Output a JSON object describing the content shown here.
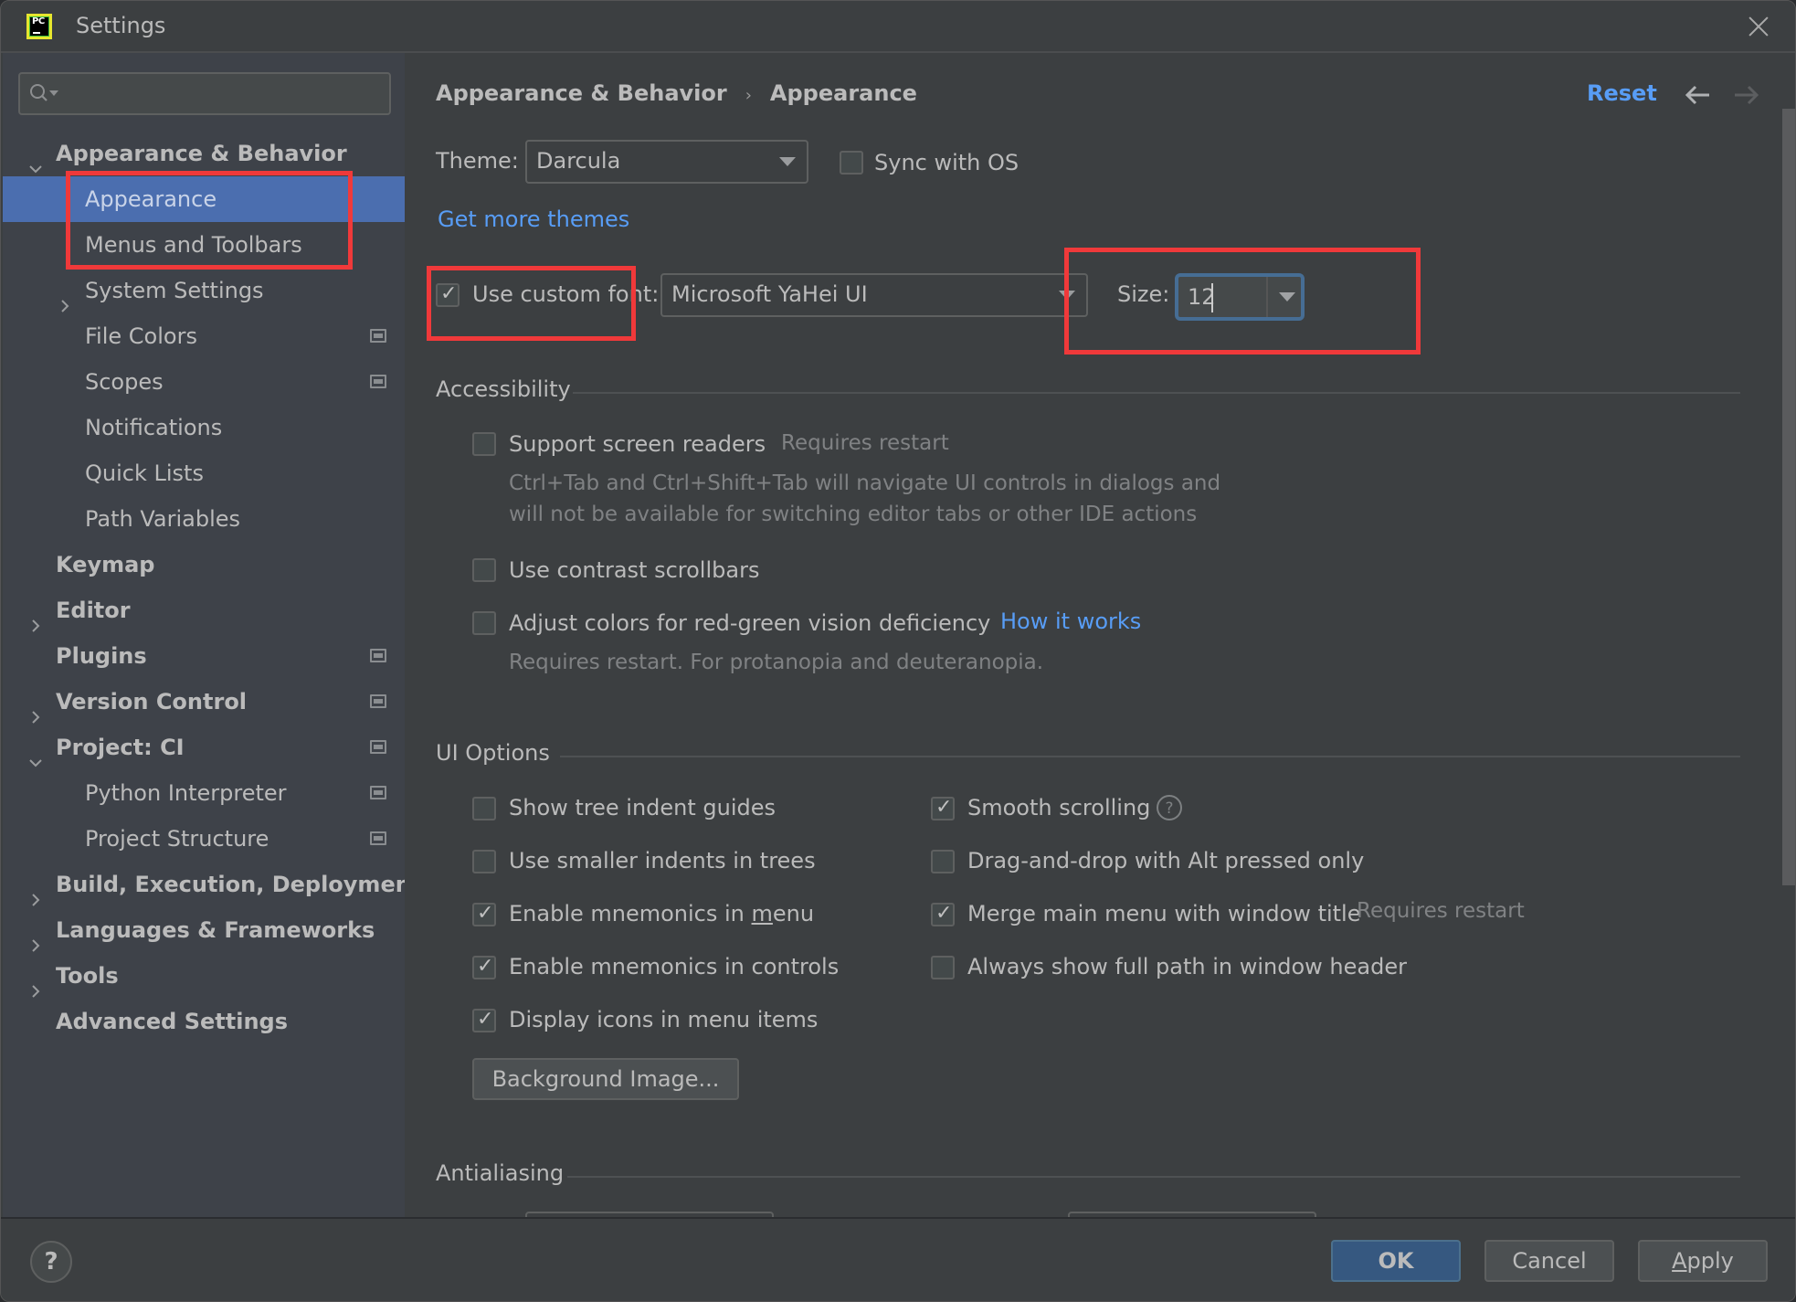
{
  "window": {
    "title": "Settings",
    "app_icon_text": "PC"
  },
  "search": {
    "placeholder": "",
    "value": ""
  },
  "sidebar": {
    "items": [
      {
        "label": "Appearance & Behavior",
        "level": 0,
        "bold": true,
        "expanded": true,
        "has_chevron": true,
        "project_icon": false
      },
      {
        "label": "Appearance",
        "level": 1,
        "bold": false,
        "selected": true,
        "has_chevron": false,
        "project_icon": false
      },
      {
        "label": "Menus and Toolbars",
        "level": 1,
        "bold": false,
        "has_chevron": false,
        "project_icon": false
      },
      {
        "label": "System Settings",
        "level": 1,
        "bold": false,
        "expanded": false,
        "has_chevron": true,
        "project_icon": false
      },
      {
        "label": "File Colors",
        "level": 1,
        "bold": false,
        "has_chevron": false,
        "project_icon": true
      },
      {
        "label": "Scopes",
        "level": 1,
        "bold": false,
        "has_chevron": false,
        "project_icon": true
      },
      {
        "label": "Notifications",
        "level": 1,
        "bold": false,
        "has_chevron": false,
        "project_icon": false
      },
      {
        "label": "Quick Lists",
        "level": 1,
        "bold": false,
        "has_chevron": false,
        "project_icon": false
      },
      {
        "label": "Path Variables",
        "level": 1,
        "bold": false,
        "has_chevron": false,
        "project_icon": false
      },
      {
        "label": "Keymap",
        "level": 0,
        "bold": true,
        "has_chevron": false,
        "project_icon": false
      },
      {
        "label": "Editor",
        "level": 0,
        "bold": true,
        "expanded": false,
        "has_chevron": true,
        "project_icon": false
      },
      {
        "label": "Plugins",
        "level": 0,
        "bold": true,
        "has_chevron": false,
        "project_icon": true
      },
      {
        "label": "Version Control",
        "level": 0,
        "bold": true,
        "expanded": false,
        "has_chevron": true,
        "project_icon": true
      },
      {
        "label": "Project: CI",
        "level": 0,
        "bold": true,
        "expanded": true,
        "has_chevron": true,
        "project_icon": true
      },
      {
        "label": "Python Interpreter",
        "level": 1,
        "bold": false,
        "has_chevron": false,
        "project_icon": true
      },
      {
        "label": "Project Structure",
        "level": 1,
        "bold": false,
        "has_chevron": false,
        "project_icon": true
      },
      {
        "label": "Build, Execution, Deployment",
        "level": 0,
        "bold": true,
        "expanded": false,
        "has_chevron": true,
        "project_icon": false
      },
      {
        "label": "Languages & Frameworks",
        "level": 0,
        "bold": true,
        "expanded": false,
        "has_chevron": true,
        "project_icon": false
      },
      {
        "label": "Tools",
        "level": 0,
        "bold": true,
        "expanded": false,
        "has_chevron": true,
        "project_icon": false
      },
      {
        "label": "Advanced Settings",
        "level": 0,
        "bold": true,
        "has_chevron": false,
        "project_icon": false
      }
    ]
  },
  "header": {
    "breadcrumb": [
      "Appearance & Behavior",
      "Appearance"
    ],
    "breadcrumb_separator": "›",
    "reset_label": "Reset"
  },
  "theme": {
    "label": "Theme:",
    "value": "Darcula",
    "sync_with_os_label": "Sync with OS",
    "sync_with_os_checked": false,
    "get_more_themes_label": "Get more themes"
  },
  "font": {
    "use_custom_font_label": "Use custom font:",
    "use_custom_font_checked": true,
    "font_value": "Microsoft YaHei UI",
    "size_label": "Size:",
    "size_value": "12"
  },
  "accessibility": {
    "title": "Accessibility",
    "support_screen_readers": {
      "label": "Support screen readers",
      "checked": false,
      "note": "Requires restart"
    },
    "screen_reader_desc_line1": "Ctrl+Tab and Ctrl+Shift+Tab will navigate UI controls in dialogs and",
    "screen_reader_desc_line2": "will not be available for switching editor tabs or other IDE actions",
    "contrast_scrollbars": {
      "label": "Use contrast scrollbars",
      "checked": false
    },
    "red_green": {
      "label": "Adjust colors for red-green vision deficiency",
      "checked": false,
      "link": "How it works",
      "note": "Requires restart. For protanopia and deuteranopia."
    }
  },
  "ui_options": {
    "title": "UI Options",
    "left": [
      {
        "label": "Show tree indent guides",
        "checked": false
      },
      {
        "label": "Use smaller indents in trees",
        "checked": false
      },
      {
        "label_pre": "Enable mnemonics in ",
        "label_u": "m",
        "label_post": "enu",
        "checked": true
      },
      {
        "label": "Enable mnemonics in controls",
        "checked": true
      },
      {
        "label": "Display icons in menu items",
        "checked": true
      }
    ],
    "right": [
      {
        "label": "Smooth scrolling",
        "checked": true,
        "help_icon": true
      },
      {
        "label": "Drag-and-drop with Alt pressed only",
        "checked": false
      },
      {
        "label": "Merge main menu with window title",
        "checked": true,
        "note": "Requires restart"
      },
      {
        "label": "Always show full path in window header",
        "checked": false
      }
    ],
    "background_image_label": "Background Image..."
  },
  "antialiasing": {
    "title": "Antialiasing"
  },
  "footer": {
    "help_label": "?",
    "ok_label": "OK",
    "cancel_label": "Cancel",
    "apply_pre": "",
    "apply_u": "A",
    "apply_post": "pply"
  },
  "colors": {
    "accent_link": "#589df6",
    "selection": "#4b6eaf",
    "annotation_red": "#f0393a",
    "primary_button": "#365880"
  }
}
